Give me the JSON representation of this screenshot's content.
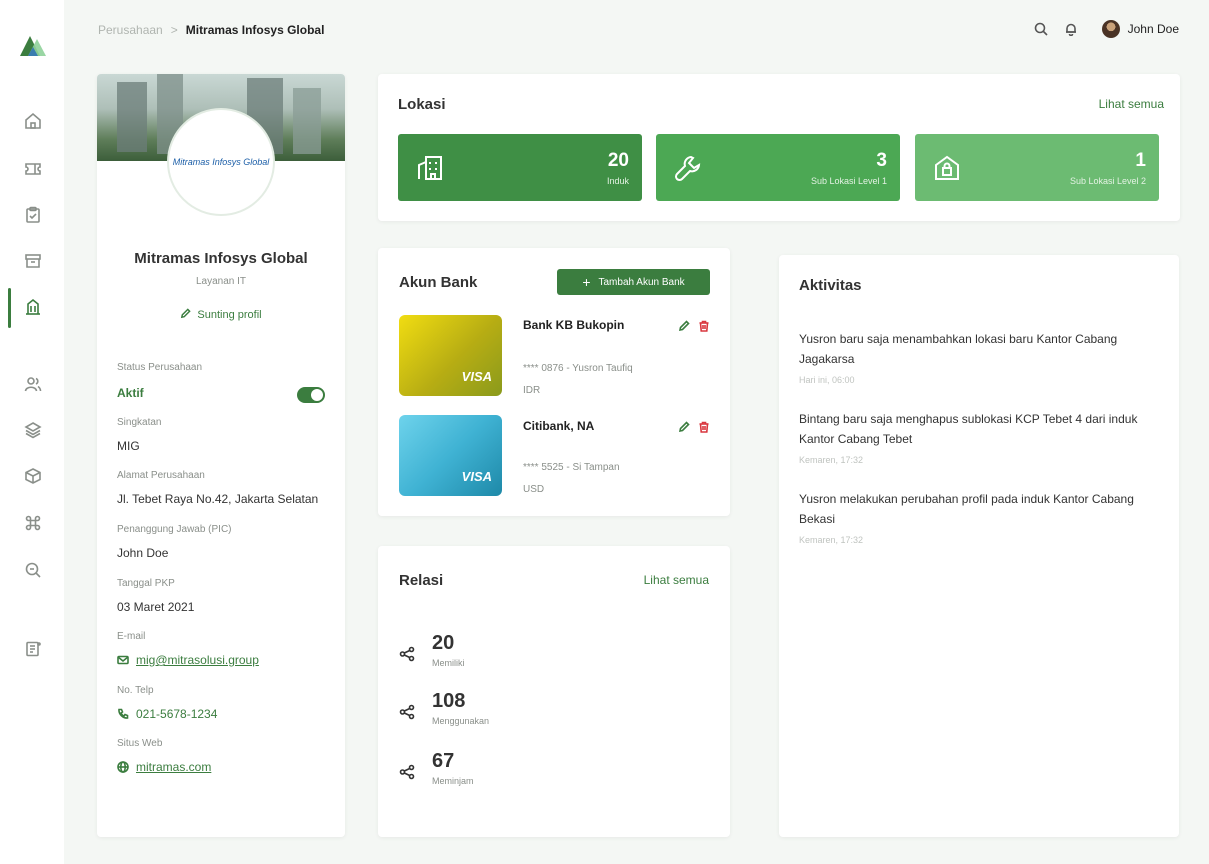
{
  "breadcrumb": {
    "parent": "Perusahaan",
    "current": "Mitramas Infosys Global"
  },
  "header": {
    "user_name": "John Doe"
  },
  "colors": {
    "accent": "#3b7d3f",
    "accent_mid": "#4ca854",
    "accent_light": "#6cbb72",
    "danger": "#d9363e"
  },
  "sidebar": {
    "icons": [
      "home-icon",
      "ticket-icon",
      "clipboard-icon",
      "archive-icon",
      "building-icon",
      "users-icon",
      "layers-icon",
      "box-icon",
      "command-icon",
      "search-zoom-icon",
      "report-icon"
    ],
    "active": "building-icon"
  },
  "profile": {
    "logo_text": "Mitramas Infosys Global",
    "name": "Mitramas Infosys Global",
    "subtitle": "Layanan IT",
    "edit_label": "Sunting profil",
    "fields": {
      "status_label": "Status Perusahaan",
      "status_value": "Aktif",
      "short_label": "Singkatan",
      "short_value": "MIG",
      "address_label": "Alamat Perusahaan",
      "address_value": "Jl. Tebet Raya No.42, Jakarta Selatan",
      "pic_label": "Penanggung Jawab (PIC)",
      "pic_value": "John Doe",
      "pkp_label": "Tanggal PKP",
      "pkp_value": "03 Maret 2021",
      "email_label": "E-mail",
      "email_value": "mig@mitrasolusi.group",
      "phone_label": "No. Telp",
      "phone_value": "021-5678-1234",
      "web_label": "Situs Web",
      "web_value": "mitramas.com"
    }
  },
  "lokasi": {
    "title": "Lokasi",
    "link": "Lihat semua",
    "boxes": [
      {
        "value": "20",
        "label": "Induk",
        "icon": "building-icon"
      },
      {
        "value": "3",
        "label": "Sub Lokasi Level 1",
        "icon": "wrench-icon"
      },
      {
        "value": "1",
        "label": "Sub Lokasi Level 2",
        "icon": "home-lock-icon"
      }
    ]
  },
  "bank": {
    "title": "Akun Bank",
    "add_label": "Tambah Akun Bank",
    "accounts": [
      {
        "name": "Bank KB Bukopin",
        "number": "**** 0876 - Yusron Taufiq",
        "currency": "IDR",
        "brand": "VISA"
      },
      {
        "name": "Citibank, NA",
        "number": "**** 5525 - Si Tampan",
        "currency": "USD",
        "brand": "VISA"
      }
    ]
  },
  "relasi": {
    "title": "Relasi",
    "link": "Lihat semua",
    "items": [
      {
        "value": "20",
        "label": "Memiliki"
      },
      {
        "value": "108",
        "label": "Menggunakan"
      },
      {
        "value": "67",
        "label": "Meminjam"
      }
    ]
  },
  "aktivitas": {
    "title": "Aktivitas",
    "items": [
      {
        "text": "Yusron baru saja menambahkan lokasi baru Kantor Cabang Jagakarsa",
        "time": "Hari ini, 06:00"
      },
      {
        "text": "Bintang baru saja menghapus sublokasi KCP Tebet 4 dari induk Kantor Cabang Tebet",
        "time": "Kemaren, 17:32"
      },
      {
        "text": "Yusron melakukan perubahan profil pada induk Kantor Cabang Bekasi",
        "time": "Kemaren, 17:32"
      }
    ]
  }
}
